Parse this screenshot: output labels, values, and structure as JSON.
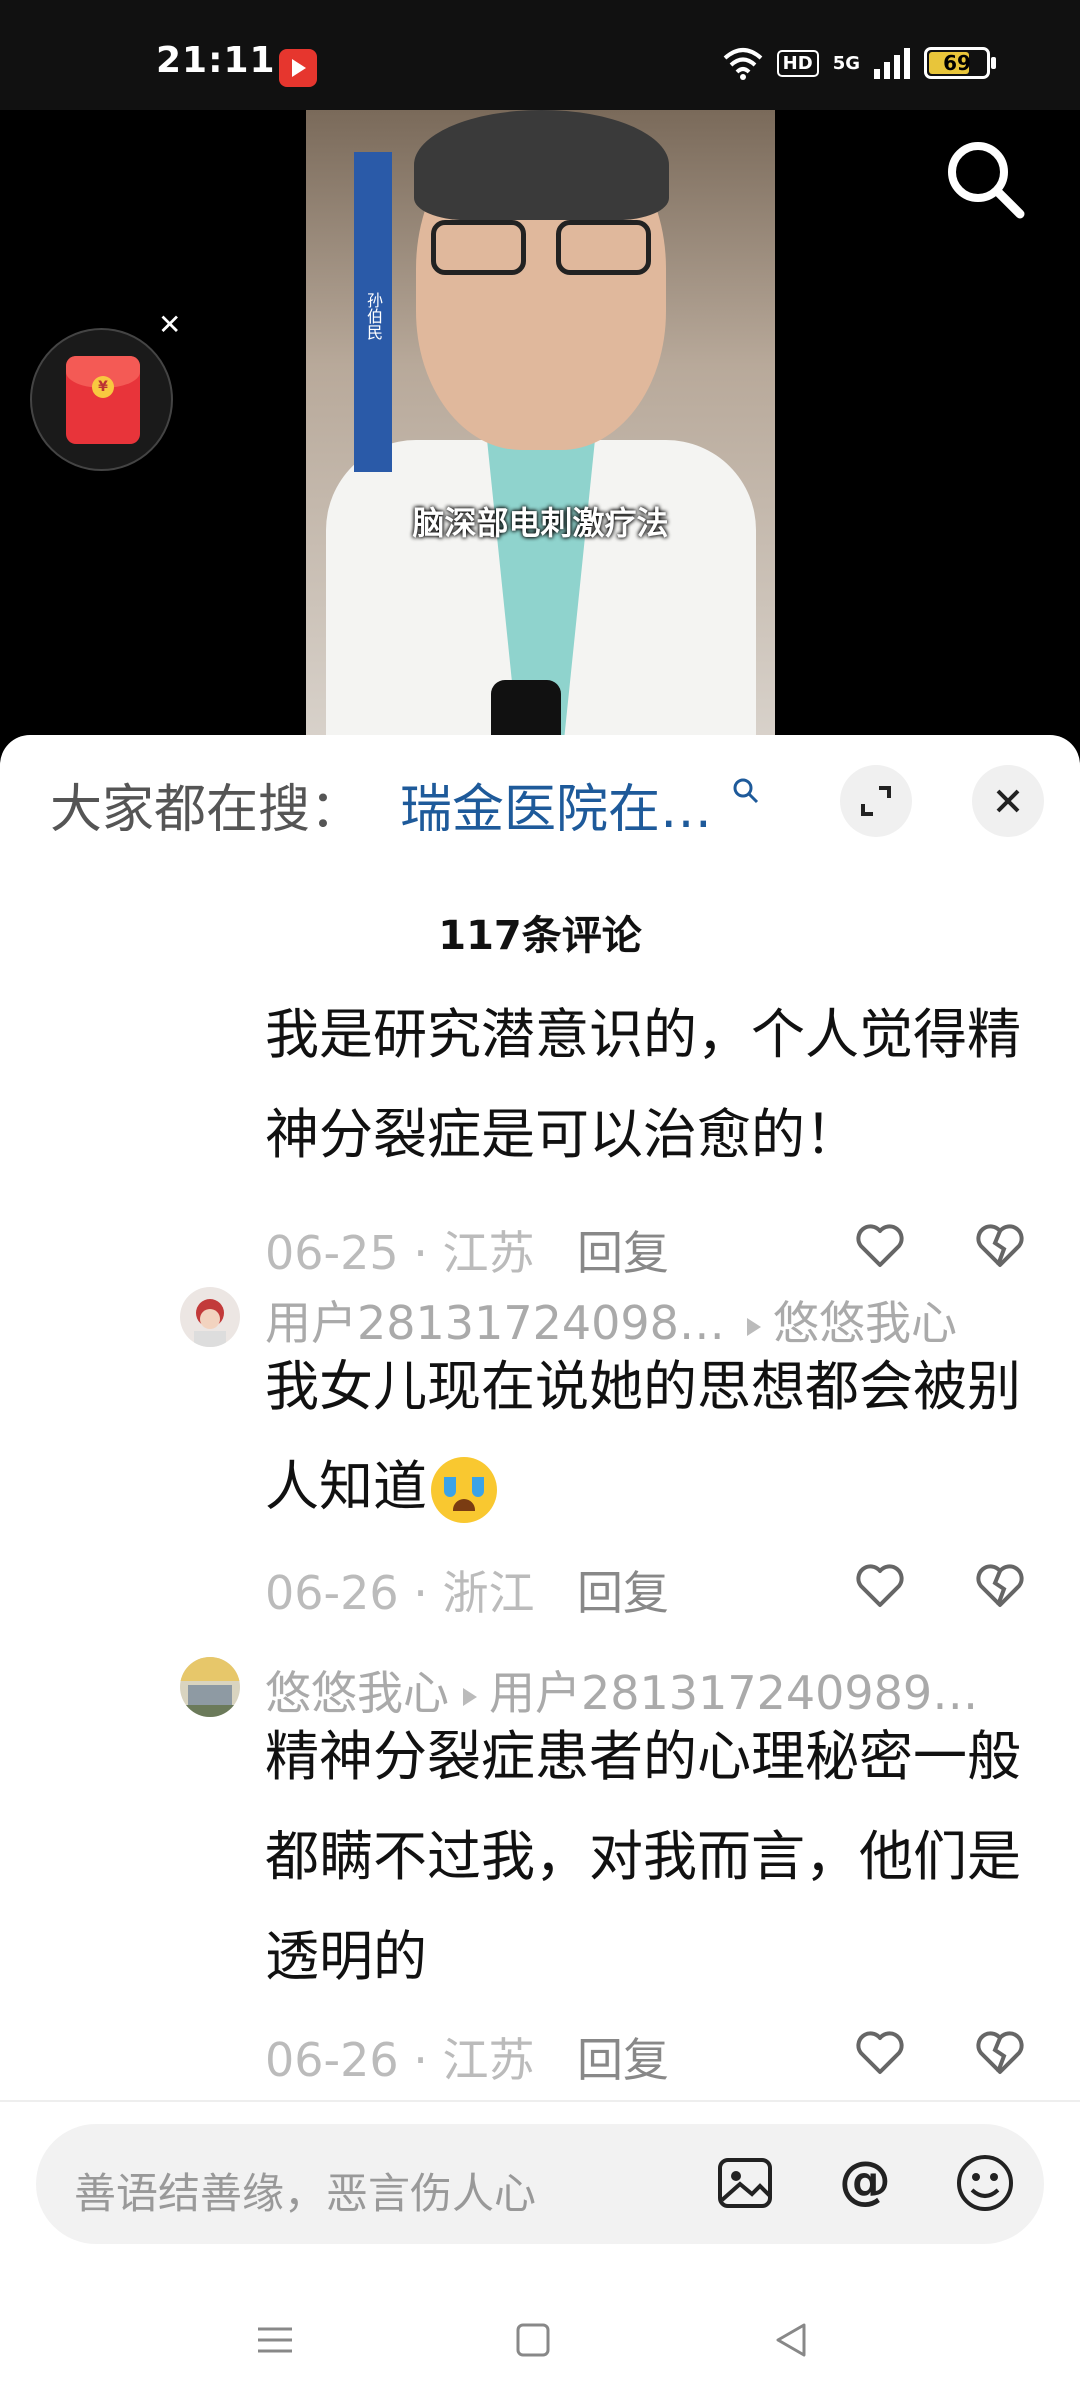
{
  "status_bar": {
    "time": "21:11",
    "network_type": "5G",
    "hd_label": "HD",
    "battery_level": "69",
    "battery_fraction": 0.69
  },
  "video": {
    "doctor_name_tag": "孙伯民",
    "subtitle": "脑深部电刺激疗法"
  },
  "sheet": {
    "trending_label": "大家都在搜：",
    "trending_query": "瑞金医院在…",
    "comment_count": "117条评论"
  },
  "comments": [
    {
      "text": "我是研究潜意识的，个人觉得精神分裂症是可以治愈的！",
      "date": "06-25 · 江苏",
      "reply_label": "回复"
    },
    {
      "user": "用户28131724098…",
      "reply_to": "悠悠我心",
      "text": "我女儿现在说她的思想都会被别人知道",
      "emoji": "crying-face-icon",
      "date": "06-26 · 浙江",
      "reply_label": "回复"
    },
    {
      "user": "悠悠我心",
      "reply_to": "用户281317240989…",
      "text": "精神分裂症患者的心理秘密一般都瞒不过我，对我而言，他们是透明的",
      "date": "06-26 · 江苏",
      "reply_label": "回复"
    }
  ],
  "input": {
    "placeholder": "善语结善缘，恶言伤人心"
  },
  "colors": {
    "link_blue": "#1e5a9a",
    "red_packet": "#e8343a",
    "status_bg": "#111111"
  }
}
